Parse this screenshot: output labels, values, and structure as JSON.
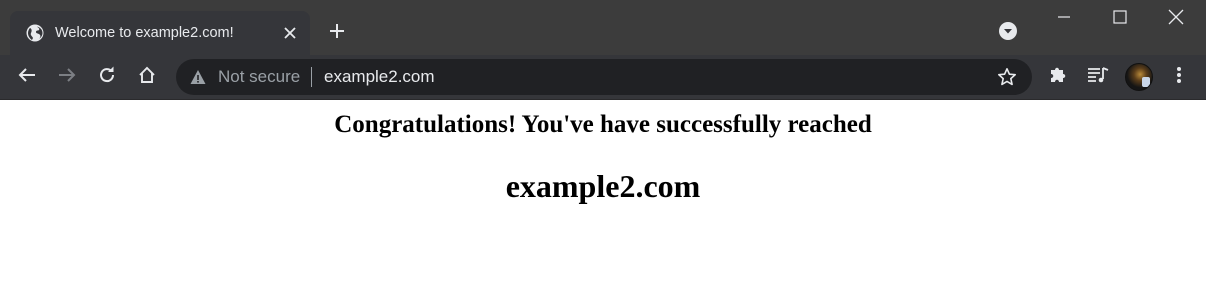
{
  "browser": {
    "tab": {
      "title": "Welcome to example2.com!",
      "favicon": "globe-icon"
    },
    "address_bar": {
      "security_label": "Not secure",
      "url": "example2.com"
    },
    "icons": [
      "globe-icon",
      "close-icon",
      "plus-icon",
      "tab-search-icon",
      "minimize-icon",
      "maximize-icon",
      "close-window-icon",
      "back-arrow-icon",
      "forward-arrow-icon",
      "reload-icon",
      "home-icon",
      "warning-icon",
      "star-icon",
      "puzzle-icon",
      "media-icon",
      "kebab-menu-icon"
    ],
    "colors": {
      "tabstrip": "#3c3c3c",
      "toolbar": "#35363a",
      "omnibox": "#202124",
      "text": "#e8eaed",
      "muted": "#9aa0a6"
    }
  },
  "page": {
    "heading": "Congratulations! You've have successfully reached",
    "domain": "example2.com"
  }
}
